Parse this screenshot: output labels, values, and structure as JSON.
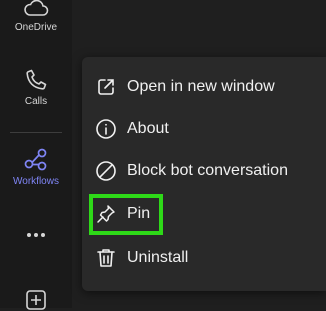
{
  "rail": {
    "items": [
      {
        "label": "OneDrive",
        "icon": "cloud-icon"
      },
      {
        "label": "Calls",
        "icon": "phone-icon"
      },
      {
        "label": "Workflows",
        "icon": "workflows-icon",
        "active": true
      },
      {
        "label": "",
        "icon": "more-options-icon"
      },
      {
        "label": "",
        "icon": "add-apps-icon"
      }
    ]
  },
  "menu": {
    "items": [
      {
        "label": "Open in new window",
        "icon": "open-external-icon"
      },
      {
        "label": "About",
        "icon": "info-icon"
      },
      {
        "label": "Block bot conversation",
        "icon": "block-icon"
      },
      {
        "label": "Pin",
        "icon": "pin-icon",
        "highlighted": true
      },
      {
        "label": "Uninstall",
        "icon": "trash-icon"
      }
    ]
  },
  "colors": {
    "rail_bg": "#1a1a1a",
    "main_bg": "#1f1f1f",
    "menu_bg": "#292929",
    "accent": "#7f85f5",
    "highlight": "#2ed918",
    "text": "#f0f0f0"
  }
}
